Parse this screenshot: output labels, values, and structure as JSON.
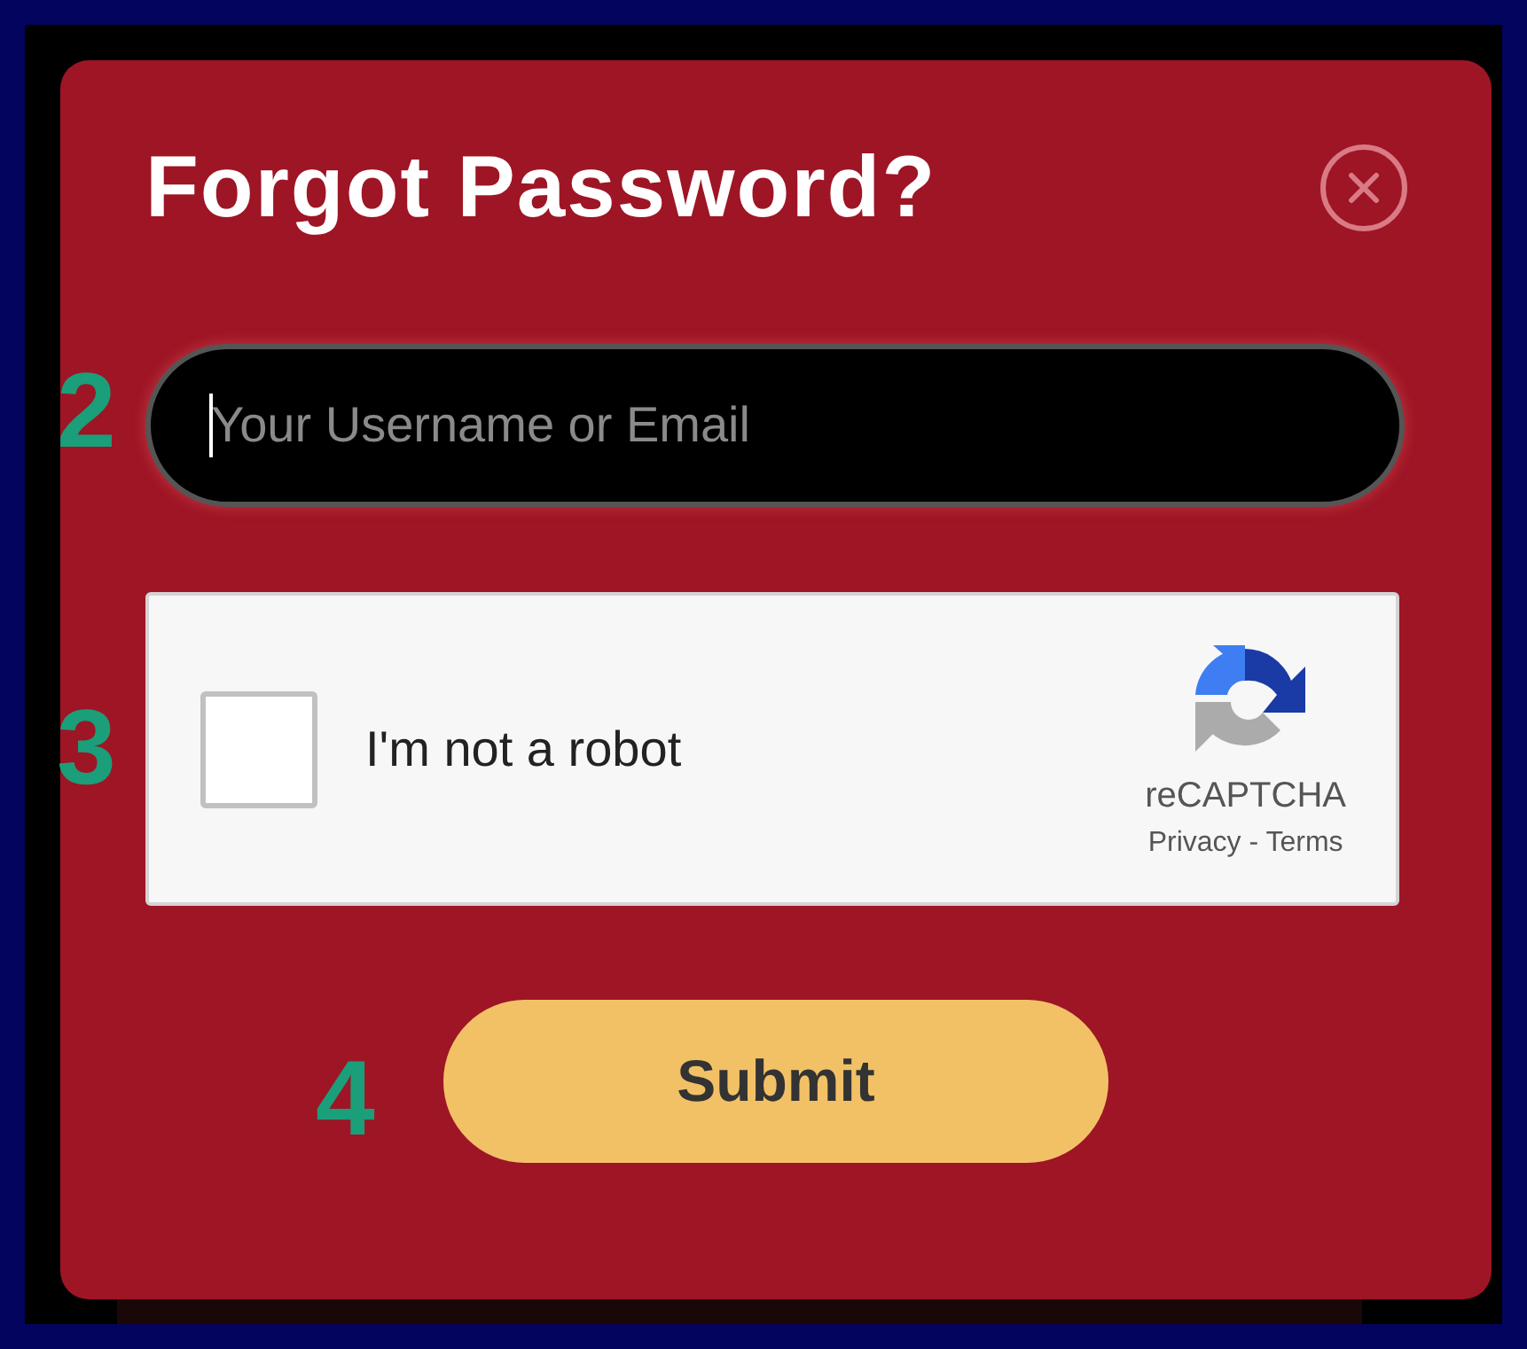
{
  "dialog": {
    "title": "Forgot Password?"
  },
  "email_field": {
    "step": "2",
    "placeholder": "Your Username or Email",
    "focused": true
  },
  "captcha": {
    "step": "3",
    "label": "I'm not a robot",
    "checked": false,
    "brand": "reCAPTCHA",
    "links": "Privacy - Terms"
  },
  "submit": {
    "step": "4",
    "label": "Submit"
  }
}
